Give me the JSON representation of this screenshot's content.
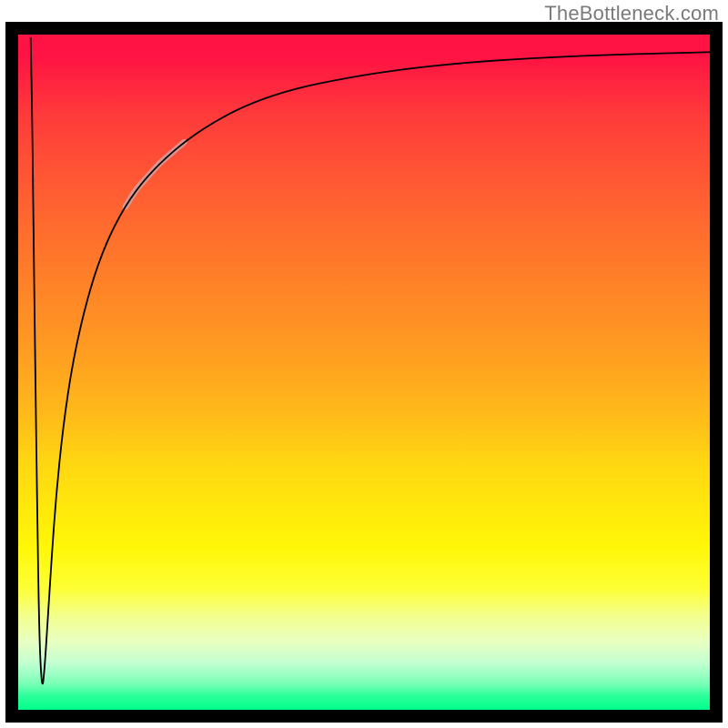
{
  "watermark": "TheBottleneck.com",
  "chart_data": {
    "type": "line",
    "title": "",
    "xlabel": "",
    "ylabel": "",
    "xlim": [
      0,
      100
    ],
    "ylim": [
      0,
      100
    ],
    "grid": false,
    "legend": false,
    "background": "rainbow-gradient-vertical",
    "notes": "x/y are normalized percentages of the plot area. Curve starts at top-left, plunges almost straight down to a narrow V-notch near the bottom-left (x≈3.5, y≈3), then rises as a logarithmic-looking curve approaching an asymptote near y≈97. A short segment around x≈16–24 is rendered as a thick faded/pale overlay on top of the black curve.",
    "series": [
      {
        "name": "curve",
        "x": [
          1.8,
          2.0,
          2.2,
          2.5,
          2.8,
          3.0,
          3.2,
          3.5,
          3.8,
          4.2,
          4.8,
          5.5,
          6.5,
          7.8,
          9.5,
          11.5,
          14.0,
          17.0,
          20.5,
          24.5,
          29.0,
          34.0,
          40.0,
          47.0,
          55.0,
          64.0,
          74.0,
          85.0,
          100.0
        ],
        "values": [
          99.5,
          90.0,
          72.0,
          48.0,
          26.0,
          14.0,
          7.0,
          3.0,
          6.0,
          12.0,
          22.0,
          32.0,
          42.0,
          51.0,
          59.0,
          66.0,
          72.0,
          77.0,
          81.0,
          84.5,
          87.5,
          90.0,
          92.0,
          93.5,
          94.8,
          95.8,
          96.5,
          97.0,
          97.4
        ]
      }
    ],
    "highlighted_segment": {
      "x_start": 15.5,
      "x_end": 24.0
    }
  }
}
